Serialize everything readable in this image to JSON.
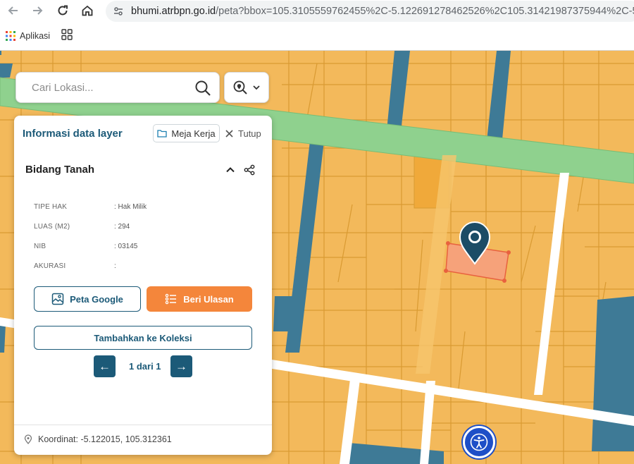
{
  "browser": {
    "url_host": "bhumi.atrbpn.go.id",
    "url_path": "/peta?bbox=105.3105559762455%2C-5.122691278462526%2C105.31421987375944%2C-5.1210",
    "bookmark_apps": "Aplikasi"
  },
  "search": {
    "placeholder": "Cari Lokasi..."
  },
  "panel": {
    "title": "Informasi data layer",
    "meja_kerja": "Meja Kerja",
    "tutup": "Tutup",
    "section": "Bidang Tanah",
    "attributes": [
      {
        "label": "TIPE HAK",
        "value": ": Hak Milik"
      },
      {
        "label": "LUAS (M2)",
        "value": ": 294"
      },
      {
        "label": "NIB",
        "value": ": 03145"
      },
      {
        "label": "AKURASI",
        "value": ":"
      }
    ],
    "btn_google": "Peta Google",
    "btn_ulasan": "Beri Ulasan",
    "btn_koleksi": "Tambahkan ke Koleksi",
    "pagination": "1 dari 1",
    "prev": "←",
    "next": "→",
    "koordinat": "Koordinat: -5.122015, 105.312361"
  },
  "colors": {
    "parcel": "#f3b95b",
    "parcel_border": "#d99a32",
    "building": "#3e7a96",
    "road_green": "#8fd18e",
    "selected": "#f6a27a",
    "accent": "#1c5a78",
    "orange_btn": "#f4863b"
  }
}
